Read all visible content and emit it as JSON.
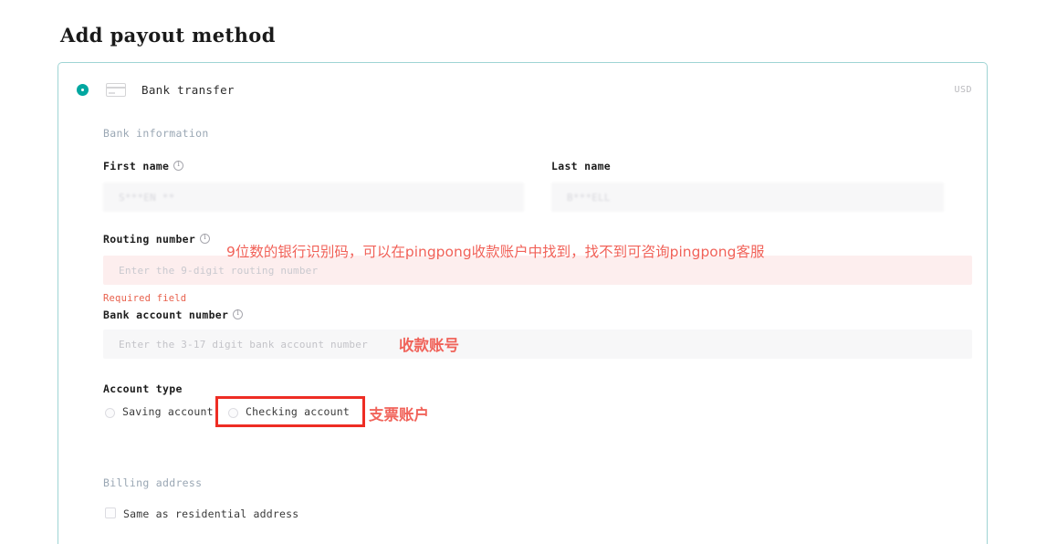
{
  "page": {
    "title": "Add payout method"
  },
  "method": {
    "label": "Bank transfer",
    "currency": "USD",
    "selected": true,
    "radio_color": "#00a7a0",
    "card_border_color": "#9fd4d4"
  },
  "sections": {
    "bank_information": "Bank information",
    "billing_address": "Billing address"
  },
  "fields": {
    "first_name": {
      "label": "First name",
      "value": "S***EN **",
      "has_info_icon": true
    },
    "last_name": {
      "label": "Last name",
      "value": "B***ELL",
      "has_info_icon": false
    },
    "routing_number": {
      "label": "Routing number",
      "placeholder": "Enter the 9-digit routing number",
      "value": "",
      "error": "Required field",
      "has_info_icon": true
    },
    "bank_account_number": {
      "label": "Bank account number",
      "placeholder": "Enter the 3-17 digit bank account number",
      "value": "",
      "has_info_icon": true
    }
  },
  "account_type": {
    "label": "Account type",
    "options": [
      {
        "label": "Saving account",
        "selected": false
      },
      {
        "label": "Checking account",
        "selected": false
      }
    ]
  },
  "billing": {
    "same_as_residential": {
      "label": "Same as residential address",
      "checked": false
    }
  },
  "annotations": {
    "routing": "9位数的银行识别码，可以在pingpong收款账户中找到，找不到可咨询pingpong客服",
    "bank_account": "收款账号",
    "checking": "支票账户",
    "color": "#f0544a",
    "highlight_color": "#ee2d24"
  },
  "icons": {
    "payment_card": "credit-card-icon",
    "info": "info-circle-icon"
  }
}
